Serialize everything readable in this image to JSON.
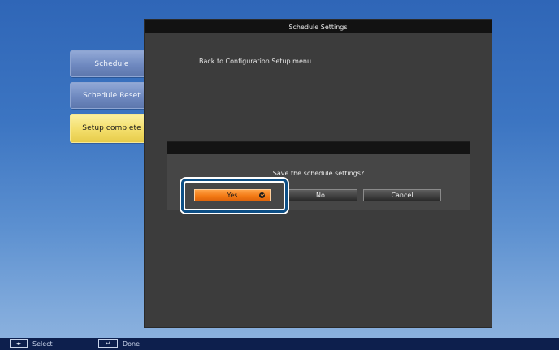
{
  "side_menu": {
    "items": [
      {
        "label": "Schedule"
      },
      {
        "label": "Schedule Reset"
      },
      {
        "label": "Setup complete"
      }
    ]
  },
  "main_panel": {
    "title": "Schedule Settings",
    "text": "Back to Configuration Setup menu"
  },
  "dialog": {
    "message": "Save the schedule settings?",
    "buttons": {
      "yes": "Yes",
      "no": "No",
      "cancel": "Cancel"
    }
  },
  "bottom_bar": {
    "select_key_icon": "left-right-arrows-icon",
    "select_label": "Select",
    "done_key_icon": "enter-key-icon",
    "done_label": "Done"
  },
  "colors": {
    "background_top": "#2f66b7",
    "background_bottom": "#8fb4df",
    "side_button": "#6f89c0",
    "side_button_selected": "#f3de6b",
    "panel": "#3c3c3c",
    "yes_button": "#f37a15",
    "highlight_border": "#0d4f86"
  }
}
